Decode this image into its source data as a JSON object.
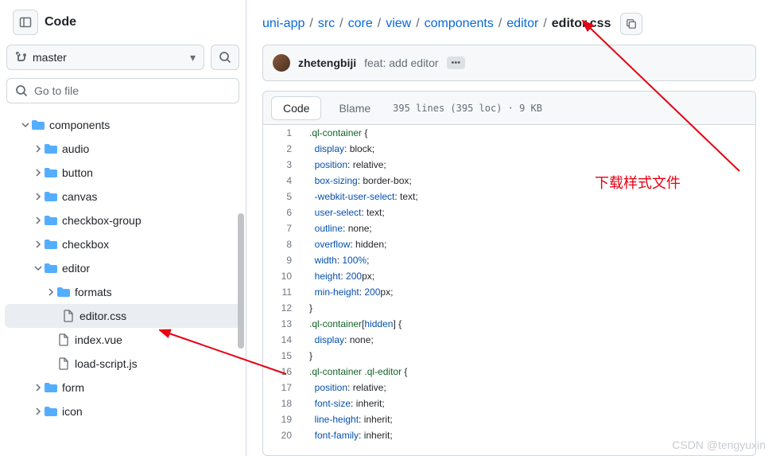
{
  "sidebar": {
    "title": "Code",
    "branch": "master",
    "goto_placeholder": "Go to file"
  },
  "tree": [
    {
      "type": "folder",
      "name": "components",
      "open": true,
      "indent": 1
    },
    {
      "type": "folder",
      "name": "audio",
      "open": false,
      "indent": 2
    },
    {
      "type": "folder",
      "name": "button",
      "open": false,
      "indent": 2
    },
    {
      "type": "folder",
      "name": "canvas",
      "open": false,
      "indent": 2
    },
    {
      "type": "folder",
      "name": "checkbox-group",
      "open": false,
      "indent": 2
    },
    {
      "type": "folder",
      "name": "checkbox",
      "open": false,
      "indent": 2
    },
    {
      "type": "folder",
      "name": "editor",
      "open": true,
      "indent": 2
    },
    {
      "type": "folder",
      "name": "formats",
      "open": false,
      "indent": 3
    },
    {
      "type": "file",
      "name": "editor.css",
      "indent": 3,
      "active": true
    },
    {
      "type": "file",
      "name": "index.vue",
      "indent": 3
    },
    {
      "type": "file",
      "name": "load-script.js",
      "indent": 3
    },
    {
      "type": "folder",
      "name": "form",
      "open": false,
      "indent": 2
    },
    {
      "type": "folder",
      "name": "icon",
      "open": false,
      "indent": 2
    }
  ],
  "crumbs": [
    "uni-app",
    "src",
    "core",
    "view",
    "components",
    "editor"
  ],
  "crumb_current": "editor.css",
  "commit": {
    "author": "zhetengbiji",
    "message": "feat: add editor"
  },
  "file": {
    "tab_code": "Code",
    "tab_blame": "Blame",
    "meta": "395 lines (395 loc) · 9 KB"
  },
  "code": [
    [
      [
        "ent",
        ".ql-container"
      ],
      [
        "p",
        " {"
      ]
    ],
    [
      [
        "p",
        "  "
      ],
      [
        "c1",
        "display"
      ],
      [
        "p",
        ": block;"
      ]
    ],
    [
      [
        "p",
        "  "
      ],
      [
        "c1",
        "position"
      ],
      [
        "p",
        ": relative;"
      ]
    ],
    [
      [
        "p",
        "  "
      ],
      [
        "c1",
        "box-sizing"
      ],
      [
        "p",
        ": border-box;"
      ]
    ],
    [
      [
        "p",
        "  "
      ],
      [
        "c1",
        "-webkit-user-select"
      ],
      [
        "p",
        ": text;"
      ]
    ],
    [
      [
        "p",
        "  "
      ],
      [
        "c1",
        "user-select"
      ],
      [
        "p",
        ": text;"
      ]
    ],
    [
      [
        "p",
        "  "
      ],
      [
        "c1",
        "outline"
      ],
      [
        "p",
        ": none;"
      ]
    ],
    [
      [
        "p",
        "  "
      ],
      [
        "c1",
        "overflow"
      ],
      [
        "p",
        ": hidden;"
      ]
    ],
    [
      [
        "p",
        "  "
      ],
      [
        "c1",
        "width"
      ],
      [
        "p",
        ": "
      ],
      [
        "c1",
        "100%"
      ],
      [
        "p",
        ";"
      ]
    ],
    [
      [
        "p",
        "  "
      ],
      [
        "c1",
        "height"
      ],
      [
        "p",
        ": "
      ],
      [
        "c1",
        "200"
      ],
      [
        "p",
        "px;"
      ]
    ],
    [
      [
        "p",
        "  "
      ],
      [
        "c1",
        "min-height"
      ],
      [
        "p",
        ": "
      ],
      [
        "c1",
        "200"
      ],
      [
        "p",
        "px;"
      ]
    ],
    [
      [
        "p",
        "}"
      ]
    ],
    [
      [
        "ent",
        ".ql-container"
      ],
      [
        "p",
        "["
      ],
      [
        "c1",
        "hidden"
      ],
      [
        "p",
        "] {"
      ]
    ],
    [
      [
        "p",
        "  "
      ],
      [
        "c1",
        "display"
      ],
      [
        "p",
        ": none;"
      ]
    ],
    [
      [
        "p",
        "}"
      ]
    ],
    [
      [
        "ent",
        ".ql-container"
      ],
      [
        "p",
        " "
      ],
      [
        "ent",
        ".ql-editor"
      ],
      [
        "p",
        " {"
      ]
    ],
    [
      [
        "p",
        "  "
      ],
      [
        "c1",
        "position"
      ],
      [
        "p",
        ": relative;"
      ]
    ],
    [
      [
        "p",
        "  "
      ],
      [
        "c1",
        "font-size"
      ],
      [
        "p",
        ": inherit;"
      ]
    ],
    [
      [
        "p",
        "  "
      ],
      [
        "c1",
        "line-height"
      ],
      [
        "p",
        ": inherit;"
      ]
    ],
    [
      [
        "p",
        "  "
      ],
      [
        "c1",
        "font-family"
      ],
      [
        "p",
        ": inherit;"
      ]
    ]
  ],
  "annotation_text": "下载样式文件",
  "watermark": "CSDN @tengyuxin"
}
